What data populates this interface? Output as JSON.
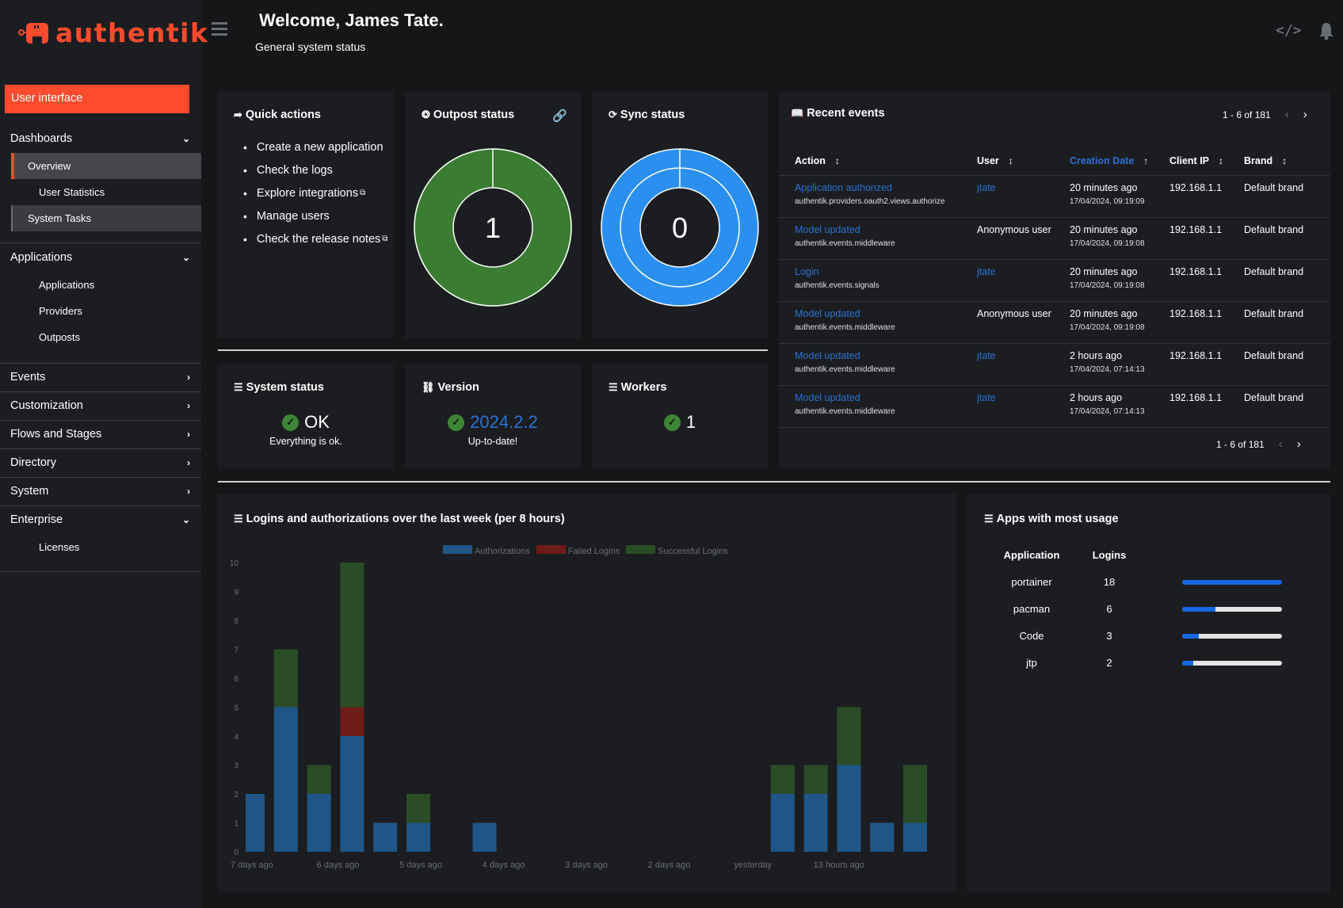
{
  "brand": {
    "name": "authentik",
    "accent": "#fd4b2d"
  },
  "sidebar": {
    "user_interface": "User interface",
    "groups": [
      {
        "label": "Dashboards",
        "expanded": true,
        "items": [
          "Overview",
          "User Statistics",
          "System Tasks"
        ],
        "active": "Overview"
      },
      {
        "label": "Applications",
        "expanded": true,
        "items": [
          "Applications",
          "Providers",
          "Outposts"
        ]
      },
      {
        "label": "Events",
        "expanded": false
      },
      {
        "label": "Customization",
        "expanded": false
      },
      {
        "label": "Flows and Stages",
        "expanded": false
      },
      {
        "label": "Directory",
        "expanded": false
      },
      {
        "label": "System",
        "expanded": false
      },
      {
        "label": "Enterprise",
        "expanded": true,
        "items": [
          "Licenses"
        ]
      }
    ]
  },
  "header": {
    "title": "Welcome, James Tate.",
    "subtitle": "General system status",
    "icons": [
      "menu-icon",
      "code-icon",
      "bell-icon"
    ]
  },
  "quick_actions": {
    "title": "Quick actions",
    "items": [
      {
        "label": "Create a new application",
        "external": false
      },
      {
        "label": "Check the logs",
        "external": false
      },
      {
        "label": "Explore integrations",
        "external": true
      },
      {
        "label": "Manage users",
        "external": false
      },
      {
        "label": "Check the release notes",
        "external": true
      }
    ]
  },
  "outpost_status": {
    "title": "Outpost status",
    "value": "1",
    "color": "#3e8635"
  },
  "sync_status": {
    "title": "Sync status",
    "value": "0",
    "color": "#2b8ff0"
  },
  "recent_events": {
    "title": "Recent events",
    "pagination": "1 - 6 of 181",
    "columns": [
      "Action",
      "User",
      "Creation Date",
      "Client IP",
      "Brand"
    ],
    "sorted_column": "Creation Date",
    "rows": [
      {
        "action": "Application authorized",
        "app": "authentik.providers.oauth2.views.authorize",
        "user": "jtate",
        "user_link": true,
        "relative": "20 minutes ago",
        "date": "17/04/2024, 09:19:09",
        "ip": "192.168.1.1",
        "brand": "Default brand"
      },
      {
        "action": "Model updated",
        "app": "authentik.events.middleware",
        "user": "Anonymous user",
        "user_link": false,
        "relative": "20 minutes ago",
        "date": "17/04/2024, 09:19:08",
        "ip": "192.168.1.1",
        "brand": "Default brand"
      },
      {
        "action": "Login",
        "app": "authentik.events.signals",
        "user": "jtate",
        "user_link": true,
        "relative": "20 minutes ago",
        "date": "17/04/2024, 09:19:08",
        "ip": "192.168.1.1",
        "brand": "Default brand"
      },
      {
        "action": "Model updated",
        "app": "authentik.events.middleware",
        "user": "Anonymous user",
        "user_link": false,
        "relative": "20 minutes ago",
        "date": "17/04/2024, 09:19:08",
        "ip": "192.168.1.1",
        "brand": "Default brand"
      },
      {
        "action": "Model updated",
        "app": "authentik.events.middleware",
        "user": "jtate",
        "user_link": true,
        "relative": "2 hours ago",
        "date": "17/04/2024, 07:14:13",
        "ip": "192.168.1.1",
        "brand": "Default brand"
      },
      {
        "action": "Model updated",
        "app": "authentik.events.middleware",
        "user": "jtate",
        "user_link": true,
        "relative": "2 hours ago",
        "date": "17/04/2024, 07:14:13",
        "ip": "192.168.1.1",
        "brand": "Default brand"
      }
    ]
  },
  "system_status": {
    "title": "System status",
    "value": "OK",
    "sub": "Everything is ok."
  },
  "version": {
    "title": "Version",
    "value": "2024.2.2",
    "sub": "Up-to-date!"
  },
  "workers": {
    "title": "Workers",
    "value": "1"
  },
  "chart_data": {
    "type": "bar",
    "stacked": true,
    "title": "Logins and authorizations over the last week (per 8 hours)",
    "legend": [
      "Authorizations",
      "Failed Logins",
      "Successful Logins"
    ],
    "legend_position": "top",
    "colors": {
      "Authorizations": "#1f5687",
      "Failed Logins": "#6e1c18",
      "Successful Logins": "#2a4d27"
    },
    "ylim": [
      0,
      10
    ],
    "yticks": [
      0,
      1,
      2,
      3,
      4,
      5,
      6,
      7,
      8,
      9,
      10
    ],
    "xtick_labels": [
      "7 days ago",
      "6 days ago",
      "5 days ago",
      "4 days ago",
      "3 days ago",
      "2 days ago",
      "yesterday",
      "13 hours ago"
    ],
    "slots": 21,
    "bars": [
      {
        "slot": 0,
        "Authorizations": 2,
        "Failed Logins": 0,
        "Successful Logins": 0
      },
      {
        "slot": 1,
        "Authorizations": 5,
        "Failed Logins": 0,
        "Successful Logins": 2
      },
      {
        "slot": 2,
        "Authorizations": 2,
        "Failed Logins": 0,
        "Successful Logins": 1
      },
      {
        "slot": 3,
        "Authorizations": 4,
        "Failed Logins": 1,
        "Successful Logins": 5
      },
      {
        "slot": 4,
        "Authorizations": 1,
        "Failed Logins": 0,
        "Successful Logins": 0
      },
      {
        "slot": 5,
        "Authorizations": 1,
        "Failed Logins": 0,
        "Successful Logins": 1
      },
      {
        "slot": 7,
        "Authorizations": 1,
        "Failed Logins": 0,
        "Successful Logins": 0
      },
      {
        "slot": 16,
        "Authorizations": 2,
        "Failed Logins": 0,
        "Successful Logins": 1
      },
      {
        "slot": 17,
        "Authorizations": 2,
        "Failed Logins": 0,
        "Successful Logins": 1
      },
      {
        "slot": 18,
        "Authorizations": 3,
        "Failed Logins": 0,
        "Successful Logins": 2
      },
      {
        "slot": 19,
        "Authorizations": 1,
        "Failed Logins": 0,
        "Successful Logins": 0
      },
      {
        "slot": 20,
        "Authorizations": 1,
        "Failed Logins": 0,
        "Successful Logins": 2
      }
    ]
  },
  "apps_usage": {
    "title": "Apps with most usage",
    "columns": [
      "Application",
      "Logins"
    ],
    "rows": [
      {
        "name": "portainer",
        "logins": "18",
        "fraction": 1.0
      },
      {
        "name": "pacman",
        "logins": "6",
        "fraction": 0.333
      },
      {
        "name": "Code",
        "logins": "3",
        "fraction": 0.167
      },
      {
        "name": "jtp",
        "logins": "2",
        "fraction": 0.111
      }
    ]
  }
}
